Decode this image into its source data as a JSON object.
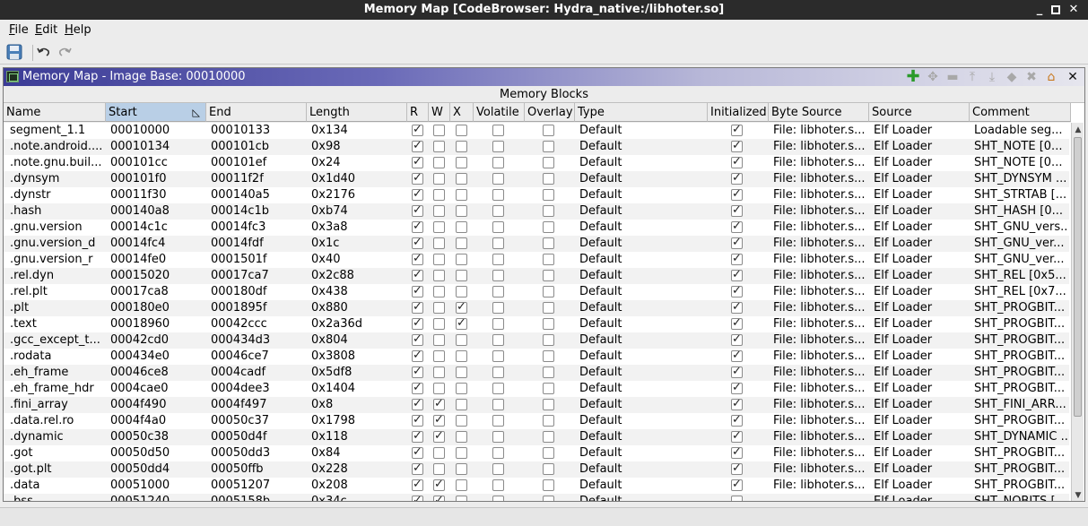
{
  "window": {
    "title": "Memory Map [CodeBrowser: Hydra_native:/libhoter.so]"
  },
  "menu": [
    {
      "key": "F",
      "rest": "ile"
    },
    {
      "key": "E",
      "rest": "dit"
    },
    {
      "key": "H",
      "rest": "elp"
    }
  ],
  "toolbar": {
    "icons": [
      "save-icon",
      "undo-icon",
      "redo-icon"
    ]
  },
  "panel": {
    "title": "Memory Map - Image Base: 00010000",
    "section_title": "Memory Blocks",
    "header_icons": [
      "add-block-icon",
      "move-block-icon",
      "split-block-icon",
      "expand-up-icon",
      "expand-down-icon",
      "merge-blocks-icon",
      "delete-block-icon",
      "set-image-base-icon",
      "close-icon"
    ]
  },
  "table": {
    "columns": [
      "Name",
      "Start",
      "End",
      "Length",
      "R",
      "W",
      "X",
      "Volatile",
      "Overlay",
      "Type",
      "Initialized",
      "Byte Source",
      "Source",
      "Comment"
    ],
    "rows": [
      {
        "name": "segment_1.1",
        "start": "00010000",
        "end": "00010133",
        "length": "0x134",
        "r": true,
        "w": false,
        "x": false,
        "volatile": false,
        "overlay": false,
        "type": "Default",
        "initialized": true,
        "byte_source": "File: libhoter.s...",
        "source": "Elf Loader",
        "comment": "Loadable seg..."
      },
      {
        "name": ".note.android....",
        "start": "00010134",
        "end": "000101cb",
        "length": "0x98",
        "r": true,
        "w": false,
        "x": false,
        "volatile": false,
        "overlay": false,
        "type": "Default",
        "initialized": true,
        "byte_source": "File: libhoter.s...",
        "source": "Elf Loader",
        "comment": "SHT_NOTE  [0..."
      },
      {
        "name": ".note.gnu.buil...",
        "start": "000101cc",
        "end": "000101ef",
        "length": "0x24",
        "r": true,
        "w": false,
        "x": false,
        "volatile": false,
        "overlay": false,
        "type": "Default",
        "initialized": true,
        "byte_source": "File: libhoter.s...",
        "source": "Elf Loader",
        "comment": "SHT_NOTE  [0..."
      },
      {
        "name": ".dynsym",
        "start": "000101f0",
        "end": "00011f2f",
        "length": "0x1d40",
        "r": true,
        "w": false,
        "x": false,
        "volatile": false,
        "overlay": false,
        "type": "Default",
        "initialized": true,
        "byte_source": "File: libhoter.s...",
        "source": "Elf Loader",
        "comment": "SHT_DYNSYM  ..."
      },
      {
        "name": ".dynstr",
        "start": "00011f30",
        "end": "000140a5",
        "length": "0x2176",
        "r": true,
        "w": false,
        "x": false,
        "volatile": false,
        "overlay": false,
        "type": "Default",
        "initialized": true,
        "byte_source": "File: libhoter.s...",
        "source": "Elf Loader",
        "comment": "SHT_STRTAB  [..."
      },
      {
        "name": ".hash",
        "start": "000140a8",
        "end": "00014c1b",
        "length": "0xb74",
        "r": true,
        "w": false,
        "x": false,
        "volatile": false,
        "overlay": false,
        "type": "Default",
        "initialized": true,
        "byte_source": "File: libhoter.s...",
        "source": "Elf Loader",
        "comment": "SHT_HASH  [0..."
      },
      {
        "name": ".gnu.version",
        "start": "00014c1c",
        "end": "00014fc3",
        "length": "0x3a8",
        "r": true,
        "w": false,
        "x": false,
        "volatile": false,
        "overlay": false,
        "type": "Default",
        "initialized": true,
        "byte_source": "File: libhoter.s...",
        "source": "Elf Loader",
        "comment": "SHT_GNU_vers..."
      },
      {
        "name": ".gnu.version_d",
        "start": "00014fc4",
        "end": "00014fdf",
        "length": "0x1c",
        "r": true,
        "w": false,
        "x": false,
        "volatile": false,
        "overlay": false,
        "type": "Default",
        "initialized": true,
        "byte_source": "File: libhoter.s...",
        "source": "Elf Loader",
        "comment": "SHT_GNU_ver..."
      },
      {
        "name": ".gnu.version_r",
        "start": "00014fe0",
        "end": "0001501f",
        "length": "0x40",
        "r": true,
        "w": false,
        "x": false,
        "volatile": false,
        "overlay": false,
        "type": "Default",
        "initialized": true,
        "byte_source": "File: libhoter.s...",
        "source": "Elf Loader",
        "comment": "SHT_GNU_ver..."
      },
      {
        "name": ".rel.dyn",
        "start": "00015020",
        "end": "00017ca7",
        "length": "0x2c88",
        "r": true,
        "w": false,
        "x": false,
        "volatile": false,
        "overlay": false,
        "type": "Default",
        "initialized": true,
        "byte_source": "File: libhoter.s...",
        "source": "Elf Loader",
        "comment": "SHT_REL  [0x5..."
      },
      {
        "name": ".rel.plt",
        "start": "00017ca8",
        "end": "000180df",
        "length": "0x438",
        "r": true,
        "w": false,
        "x": false,
        "volatile": false,
        "overlay": false,
        "type": "Default",
        "initialized": true,
        "byte_source": "File: libhoter.s...",
        "source": "Elf Loader",
        "comment": "SHT_REL  [0x7..."
      },
      {
        "name": ".plt",
        "start": "000180e0",
        "end": "0001895f",
        "length": "0x880",
        "r": true,
        "w": false,
        "x": true,
        "volatile": false,
        "overlay": false,
        "type": "Default",
        "initialized": true,
        "byte_source": "File: libhoter.s...",
        "source": "Elf Loader",
        "comment": "SHT_PROGBIT..."
      },
      {
        "name": ".text",
        "start": "00018960",
        "end": "00042ccc",
        "length": "0x2a36d",
        "r": true,
        "w": false,
        "x": true,
        "volatile": false,
        "overlay": false,
        "type": "Default",
        "initialized": true,
        "byte_source": "File: libhoter.s...",
        "source": "Elf Loader",
        "comment": "SHT_PROGBIT..."
      },
      {
        "name": ".gcc_except_t...",
        "start": "00042cd0",
        "end": "000434d3",
        "length": "0x804",
        "r": true,
        "w": false,
        "x": false,
        "volatile": false,
        "overlay": false,
        "type": "Default",
        "initialized": true,
        "byte_source": "File: libhoter.s...",
        "source": "Elf Loader",
        "comment": "SHT_PROGBIT..."
      },
      {
        "name": ".rodata",
        "start": "000434e0",
        "end": "00046ce7",
        "length": "0x3808",
        "r": true,
        "w": false,
        "x": false,
        "volatile": false,
        "overlay": false,
        "type": "Default",
        "initialized": true,
        "byte_source": "File: libhoter.s...",
        "source": "Elf Loader",
        "comment": "SHT_PROGBIT..."
      },
      {
        "name": ".eh_frame",
        "start": "00046ce8",
        "end": "0004cadf",
        "length": "0x5df8",
        "r": true,
        "w": false,
        "x": false,
        "volatile": false,
        "overlay": false,
        "type": "Default",
        "initialized": true,
        "byte_source": "File: libhoter.s...",
        "source": "Elf Loader",
        "comment": "SHT_PROGBIT..."
      },
      {
        "name": ".eh_frame_hdr",
        "start": "0004cae0",
        "end": "0004dee3",
        "length": "0x1404",
        "r": true,
        "w": false,
        "x": false,
        "volatile": false,
        "overlay": false,
        "type": "Default",
        "initialized": true,
        "byte_source": "File: libhoter.s...",
        "source": "Elf Loader",
        "comment": "SHT_PROGBIT..."
      },
      {
        "name": ".fini_array",
        "start": "0004f490",
        "end": "0004f497",
        "length": "0x8",
        "r": true,
        "w": true,
        "x": false,
        "volatile": false,
        "overlay": false,
        "type": "Default",
        "initialized": true,
        "byte_source": "File: libhoter.s...",
        "source": "Elf Loader",
        "comment": "SHT_FINI_ARR..."
      },
      {
        "name": ".data.rel.ro",
        "start": "0004f4a0",
        "end": "00050c37",
        "length": "0x1798",
        "r": true,
        "w": true,
        "x": false,
        "volatile": false,
        "overlay": false,
        "type": "Default",
        "initialized": true,
        "byte_source": "File: libhoter.s...",
        "source": "Elf Loader",
        "comment": "SHT_PROGBIT..."
      },
      {
        "name": ".dynamic",
        "start": "00050c38",
        "end": "00050d4f",
        "length": "0x118",
        "r": true,
        "w": true,
        "x": false,
        "volatile": false,
        "overlay": false,
        "type": "Default",
        "initialized": true,
        "byte_source": "File: libhoter.s...",
        "source": "Elf Loader",
        "comment": "SHT_DYNAMIC ..."
      },
      {
        "name": ".got",
        "start": "00050d50",
        "end": "00050dd3",
        "length": "0x84",
        "r": true,
        "w": false,
        "x": false,
        "volatile": false,
        "overlay": false,
        "type": "Default",
        "initialized": true,
        "byte_source": "File: libhoter.s...",
        "source": "Elf Loader",
        "comment": "SHT_PROGBIT..."
      },
      {
        "name": ".got.plt",
        "start": "00050dd4",
        "end": "00050ffb",
        "length": "0x228",
        "r": true,
        "w": false,
        "x": false,
        "volatile": false,
        "overlay": false,
        "type": "Default",
        "initialized": true,
        "byte_source": "File: libhoter.s...",
        "source": "Elf Loader",
        "comment": "SHT_PROGBIT..."
      },
      {
        "name": ".data",
        "start": "00051000",
        "end": "00051207",
        "length": "0x208",
        "r": true,
        "w": true,
        "x": false,
        "volatile": false,
        "overlay": false,
        "type": "Default",
        "initialized": true,
        "byte_source": "File: libhoter.s...",
        "source": "Elf Loader",
        "comment": "SHT_PROGBIT..."
      },
      {
        "name": ".bss",
        "start": "00051240",
        "end": "0005158b",
        "length": "0x34c",
        "r": true,
        "w": true,
        "x": false,
        "volatile": false,
        "overlay": false,
        "type": "Default",
        "initialized": false,
        "byte_source": "",
        "source": "Elf Loader",
        "comment": "SHT_NOBITS  [..."
      }
    ]
  },
  "colors": {
    "titlebar": "#2b2b2b",
    "header_gradient_start": "#3c3c96",
    "sorted_header": "#b9cfe6",
    "add_icon": "#2a9a2a"
  }
}
